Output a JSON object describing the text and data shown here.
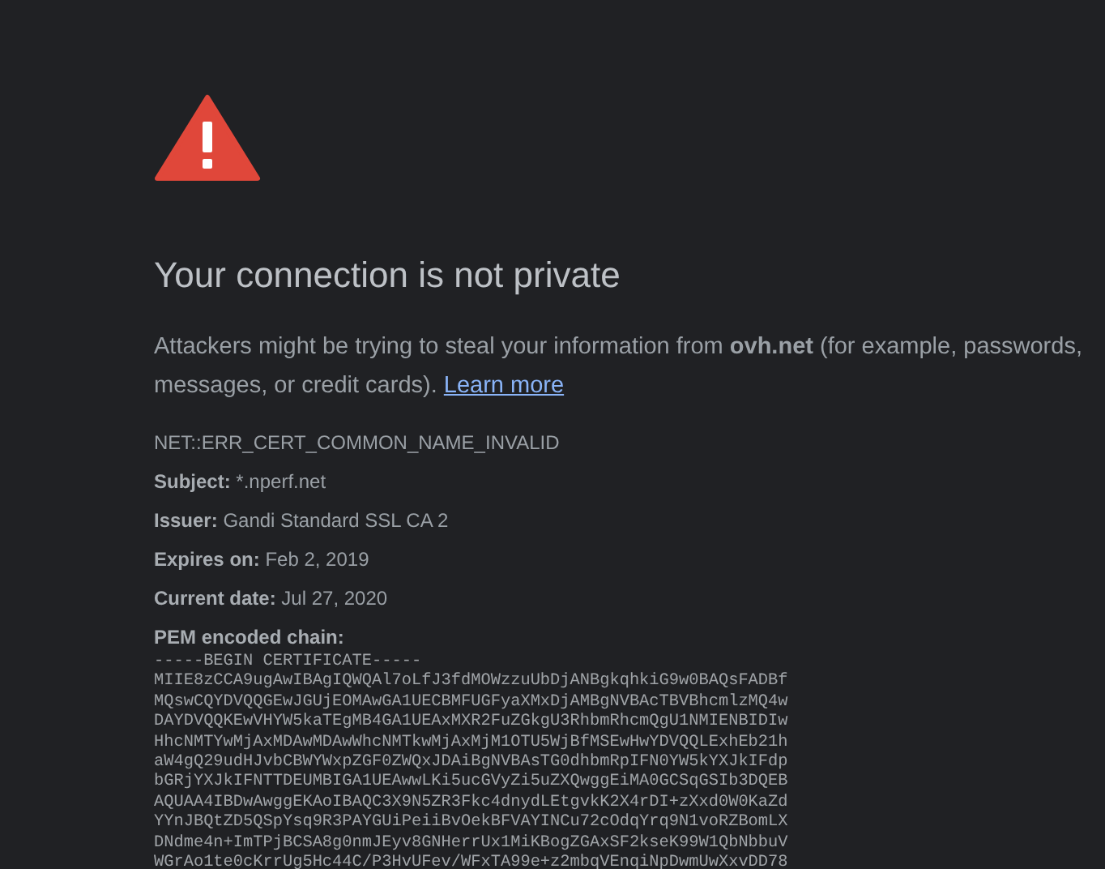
{
  "heading": "Your connection is not private",
  "message": {
    "text": "Attackers might be trying to steal your information from **ovh.net** (for example, passwords, messages, or credit cards).",
    "link": "Learn more"
  },
  "error_code": "NET::ERR_CERT_COMMON_NAME_INVALID",
  "details": [
    {
      "label": "Subject:",
      "value": "*.nperf.net"
    },
    {
      "label": "Issuer:",
      "value": "Gandi Standard SSL CA 2"
    },
    {
      "label": "Expires on:",
      "value": "Feb 2, 2019"
    },
    {
      "label": "Current date:",
      "value": "Jul 27, 2020"
    }
  ],
  "pem": {
    "label": "PEM encoded chain:",
    "lines": [
      "-----BEGIN CERTIFICATE-----",
      "MIIE8zCCA9ugAwIBAgIQWQAl7oLfJ3fdMOWzzuUbDjANBgkqhkiG9w0BAQsFADBf",
      "MQswCQYDVQQGEwJGUjEOMAwGA1UECBMFUGFyaXMxDjAMBgNVBAcTBVBhcmlzMQ4w",
      "DAYDVQQKEwVHYW5kaTEgMB4GA1UEAxMXR2FuZGkgU3RhbmRhcmQgU1NMIENBIDIw",
      "HhcNMTYwMjAxMDAwMDAwWhcNMTkwMjAxMjM1OTU5WjBfMSEwHwYDVQQLExhEb21h",
      "aW4gQ29udHJvbCBWYWxpZGF0ZWQxJDAiBgNVBAsTG0dhbmRpIFN0YW5kYXJkIFdp",
      "bGRjYXJkIFNTTDEUMBIGA1UEAwwLKi5ucGVyZi5uZXQwggEiMA0GCSqGSIb3DQEB",
      "AQUAA4IBDwAwggEKAoIBAQC3X9N5ZR3Fkc4dnydLEtgvkK2X4rDI+zXxd0W0KaZd",
      "YYnJBQtZD5QSpYsq9R3PAYGUiPeiiBvOekBFVAYINCu72cOdqYrq9N1voRZBomLX",
      "DNdme4n+ImTPjBCSA8g0nmJEyv8GNHerrUx1MiKBogZGAxSF2kseK99W1QbNbbuV",
      "WGrAo1te0cKrrUg5Hc44C/P3HvUFev/WFxTA99e+z2mbqVEnqiNpDwmUwXxvDD78"
    ]
  }
}
